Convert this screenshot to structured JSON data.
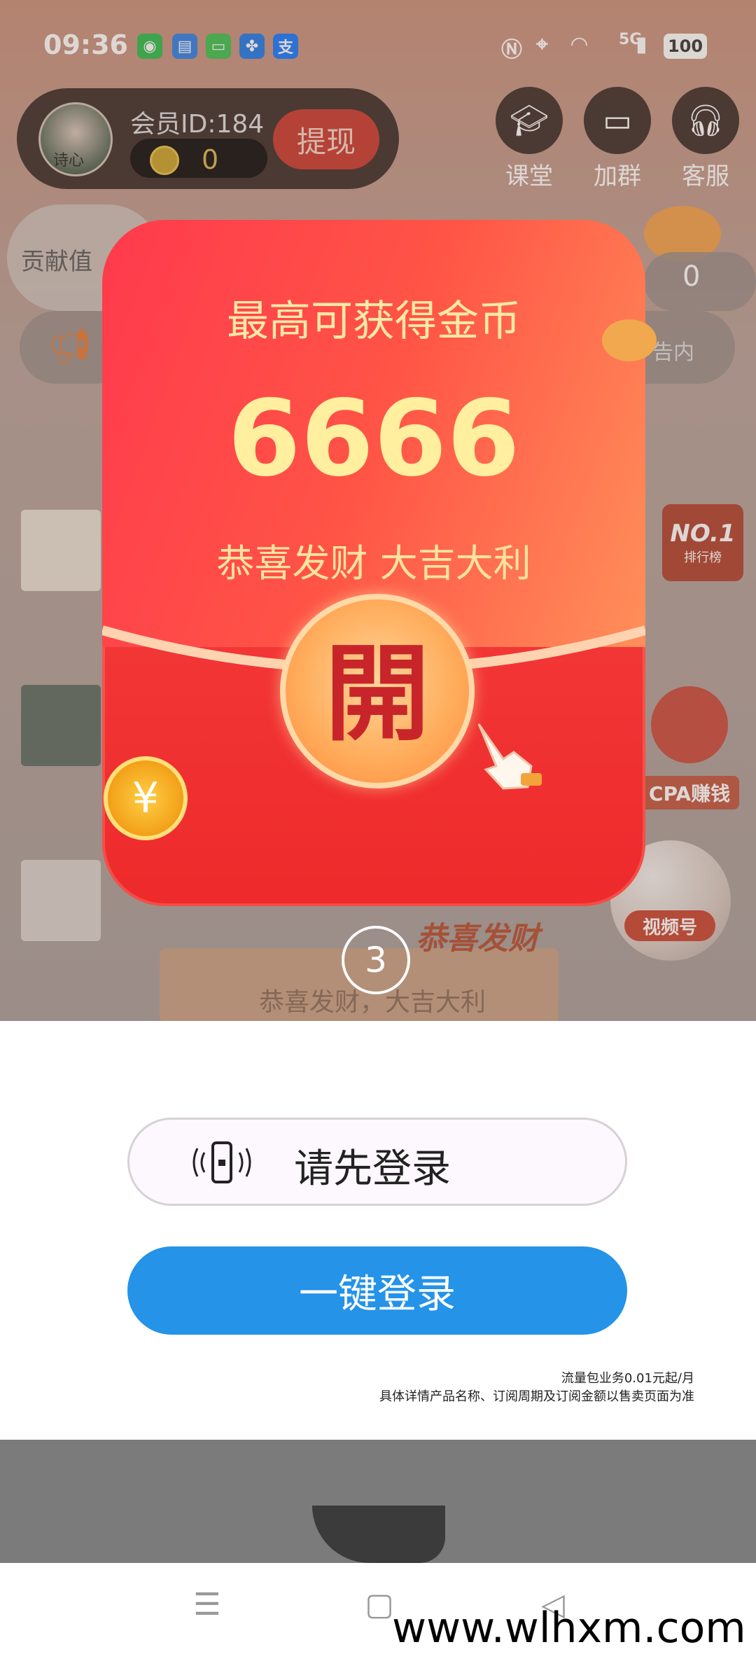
{
  "status_bar": {
    "time": "09:36",
    "apps": [
      "wechat-icon",
      "message-icon",
      "sms-icon",
      "pinwheel-icon",
      "alipay-icon"
    ],
    "alipay_char": "支",
    "network": "5G",
    "battery": "100"
  },
  "header": {
    "member_id": "会员ID:184",
    "coins": "0",
    "withdraw_label": "提现",
    "buttons": [
      {
        "label": "课堂",
        "icon": "graduation-cap-icon"
      },
      {
        "label": "加群",
        "icon": "chat-bubbles-icon"
      },
      {
        "label": "客服",
        "icon": "headset-icon"
      }
    ],
    "avatar_text": "诗心"
  },
  "side_left": {
    "contribution_label": "贡献值"
  },
  "side_right": {
    "score": "0",
    "ad_text": "告内",
    "rank_badge": "NO.1",
    "rank_sub": "排行榜",
    "cpa_label": "CPA赚钱",
    "video_label": "视频号"
  },
  "banner": {
    "text": "恭喜发财，大吉大利",
    "logo_text": "恭喜发财"
  },
  "red_envelope": {
    "title": "最高可获得金币",
    "amount": "6666",
    "blessing": "恭喜发财 大吉大利",
    "open_char": "開",
    "coin_symbol": "¥"
  },
  "countdown": "3",
  "login": {
    "login_first_label": "请先登录",
    "one_key_label": "一键登录",
    "notice_line1": "流量包业务0.01元起/月",
    "notice_line2": "具体详情产品名称、订阅周期及订阅金额以售卖页面为准"
  },
  "nav": {
    "menu_icon": "☰",
    "home_icon": "▢",
    "back_icon": "◁"
  },
  "watermark": "www.wlhxm.com",
  "colors": {
    "envelope_red": "#f43b3a",
    "gold_text": "#ffef9e",
    "primary_blue": "#2493e8"
  }
}
